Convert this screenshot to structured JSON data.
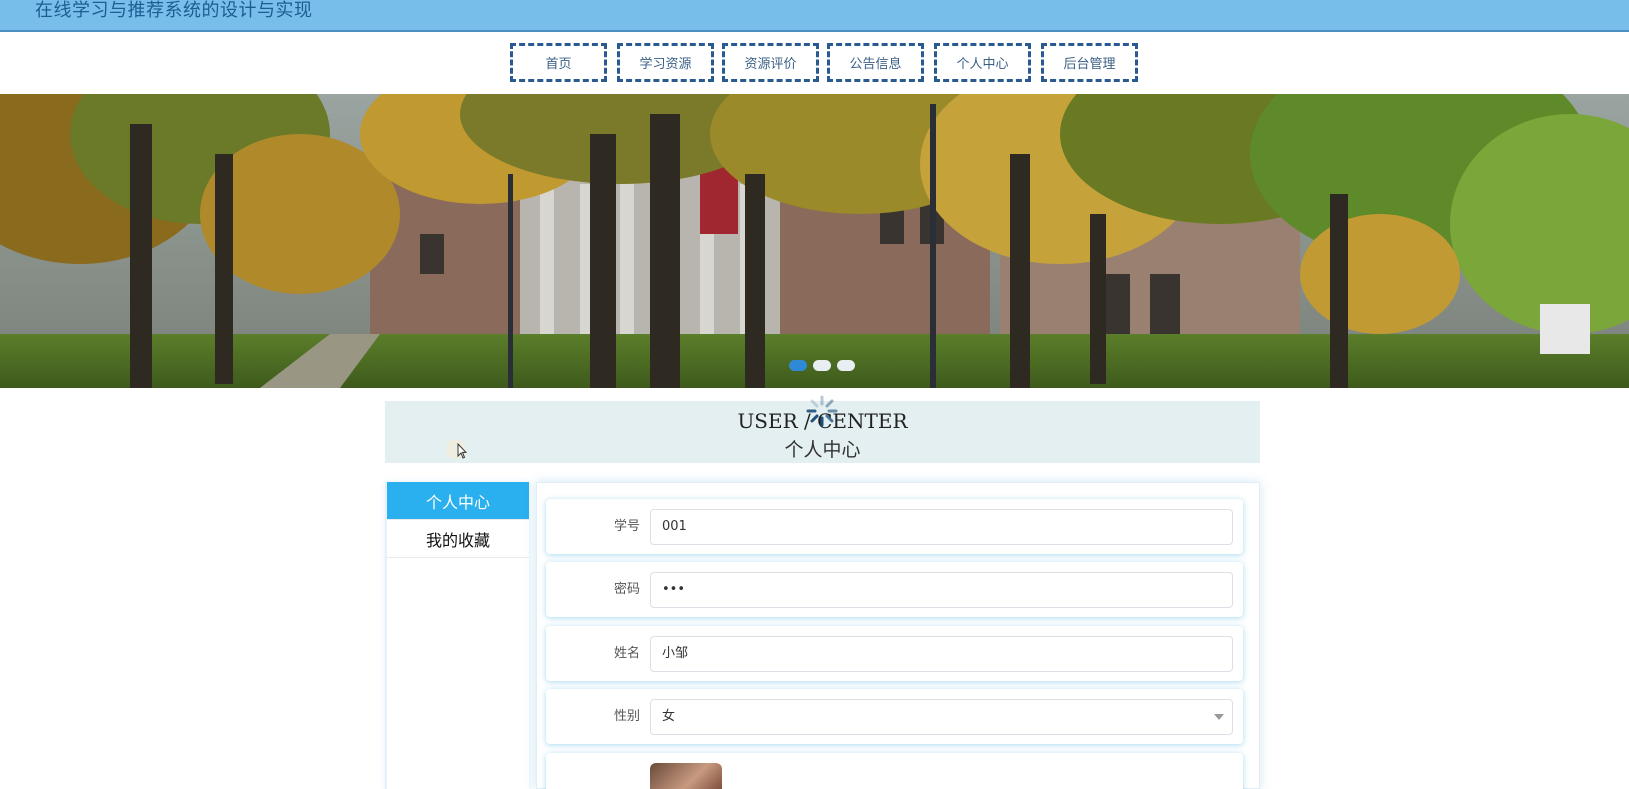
{
  "app": {
    "title": "在线学习与推荐系统的设计与实现"
  },
  "nav": {
    "items": [
      {
        "label": "首页"
      },
      {
        "label": "学习资源"
      },
      {
        "label": "资源评价"
      },
      {
        "label": "公告信息"
      },
      {
        "label": "个人中心"
      },
      {
        "label": "后台管理"
      }
    ]
  },
  "banner": {
    "dots": [
      {
        "active": true
      },
      {
        "active": false
      },
      {
        "active": false
      }
    ]
  },
  "user_center": {
    "title_en": "USER / CENTER",
    "title_zh": "个人中心"
  },
  "side_menu": {
    "items": [
      {
        "label": "个人中心",
        "active": true
      },
      {
        "label": "我的收藏",
        "active": false
      }
    ]
  },
  "form": {
    "student_id": {
      "label": "学号",
      "value": "001"
    },
    "password": {
      "label": "密码",
      "value": "•••"
    },
    "name": {
      "label": "姓名",
      "value": "小邹"
    },
    "gender": {
      "label": "性别",
      "value": "女"
    }
  },
  "colors": {
    "header_bg": "#77bfea",
    "nav_border": "#2a5a92",
    "active_tab": "#2ab0ef",
    "active_dot": "#2f8ad6"
  }
}
